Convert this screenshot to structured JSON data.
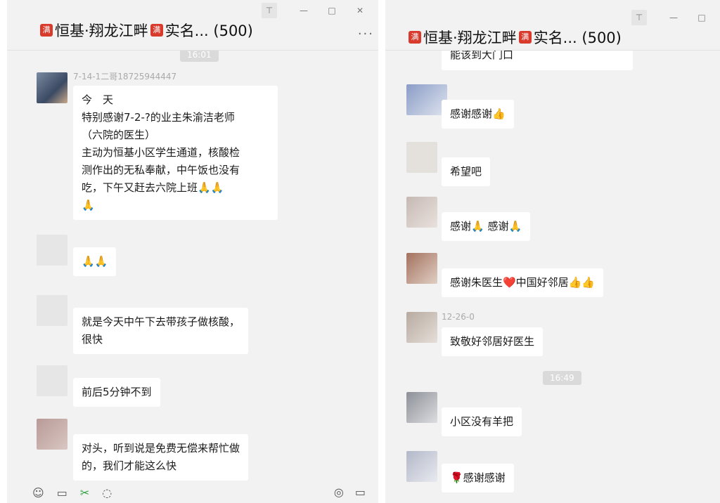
{
  "left": {
    "title": "恒基·翔龙江畔",
    "title_suffix": "实名... (500)",
    "badge": "满",
    "time": "16:01",
    "messages": [
      {
        "sender": "7-14-1二哥18725944447",
        "lines": [
          "今　天",
          "特别感谢7-2-?的业主朱渝洁老师",
          "（六院的医生）",
          "主动为恒基小区学生通道，核酸检",
          "测作出的无私奉献，中午饭也没有",
          "吃，下午又赶去六院上班🙏🙏",
          "🙏"
        ]
      },
      {
        "sender": "",
        "lines": [
          "🙏🙏"
        ]
      },
      {
        "sender": "",
        "lines": [
          "就是今天中午下去带孩子做核酸，",
          "很快"
        ]
      },
      {
        "sender": "",
        "lines": [
          "前后5分钟不到"
        ]
      },
      {
        "sender": "",
        "lines": [
          "对头，听到说是免费无偿来帮忙做",
          "的，我们才能这么快"
        ]
      }
    ]
  },
  "right": {
    "title": "恒基·翔龙江畔",
    "title_suffix": "实名... (500)",
    "badge": "满",
    "time": "16:49",
    "partial_top": "能该到大门口",
    "messages": [
      {
        "sender": "",
        "text": "感谢感谢👍"
      },
      {
        "sender": "",
        "text": "希望吧"
      },
      {
        "sender": "",
        "text": "感谢🙏 感谢🙏"
      },
      {
        "sender": "",
        "text": "感谢朱医生❤️中国好邻居👍👍"
      },
      {
        "sender": "12-26-0 ",
        "text": "致敬好邻居好医生"
      },
      {
        "sender": "",
        "text": "小区没有羊把"
      },
      {
        "sender": "",
        "text": "🌹感谢感谢"
      }
    ]
  },
  "icons": {
    "pin": "pin-icon",
    "minimize": "minimize-icon",
    "maximize": "maximize-icon",
    "close": "close-icon",
    "more": "more-icon",
    "emoji": "emoji-icon",
    "folder": "folder-icon",
    "scissors": "scissors-icon",
    "chat": "chat-bubble-icon",
    "voice": "voice-call-icon",
    "video": "video-call-icon"
  },
  "glyphs": {
    "pin": "⊤",
    "minimize": "—",
    "maximize": "□",
    "close": "✕",
    "more": "···",
    "emoji": "☺",
    "folder": "▭",
    "scissors": "✂",
    "chat": "◌",
    "voice": "◎",
    "video": "▭"
  }
}
